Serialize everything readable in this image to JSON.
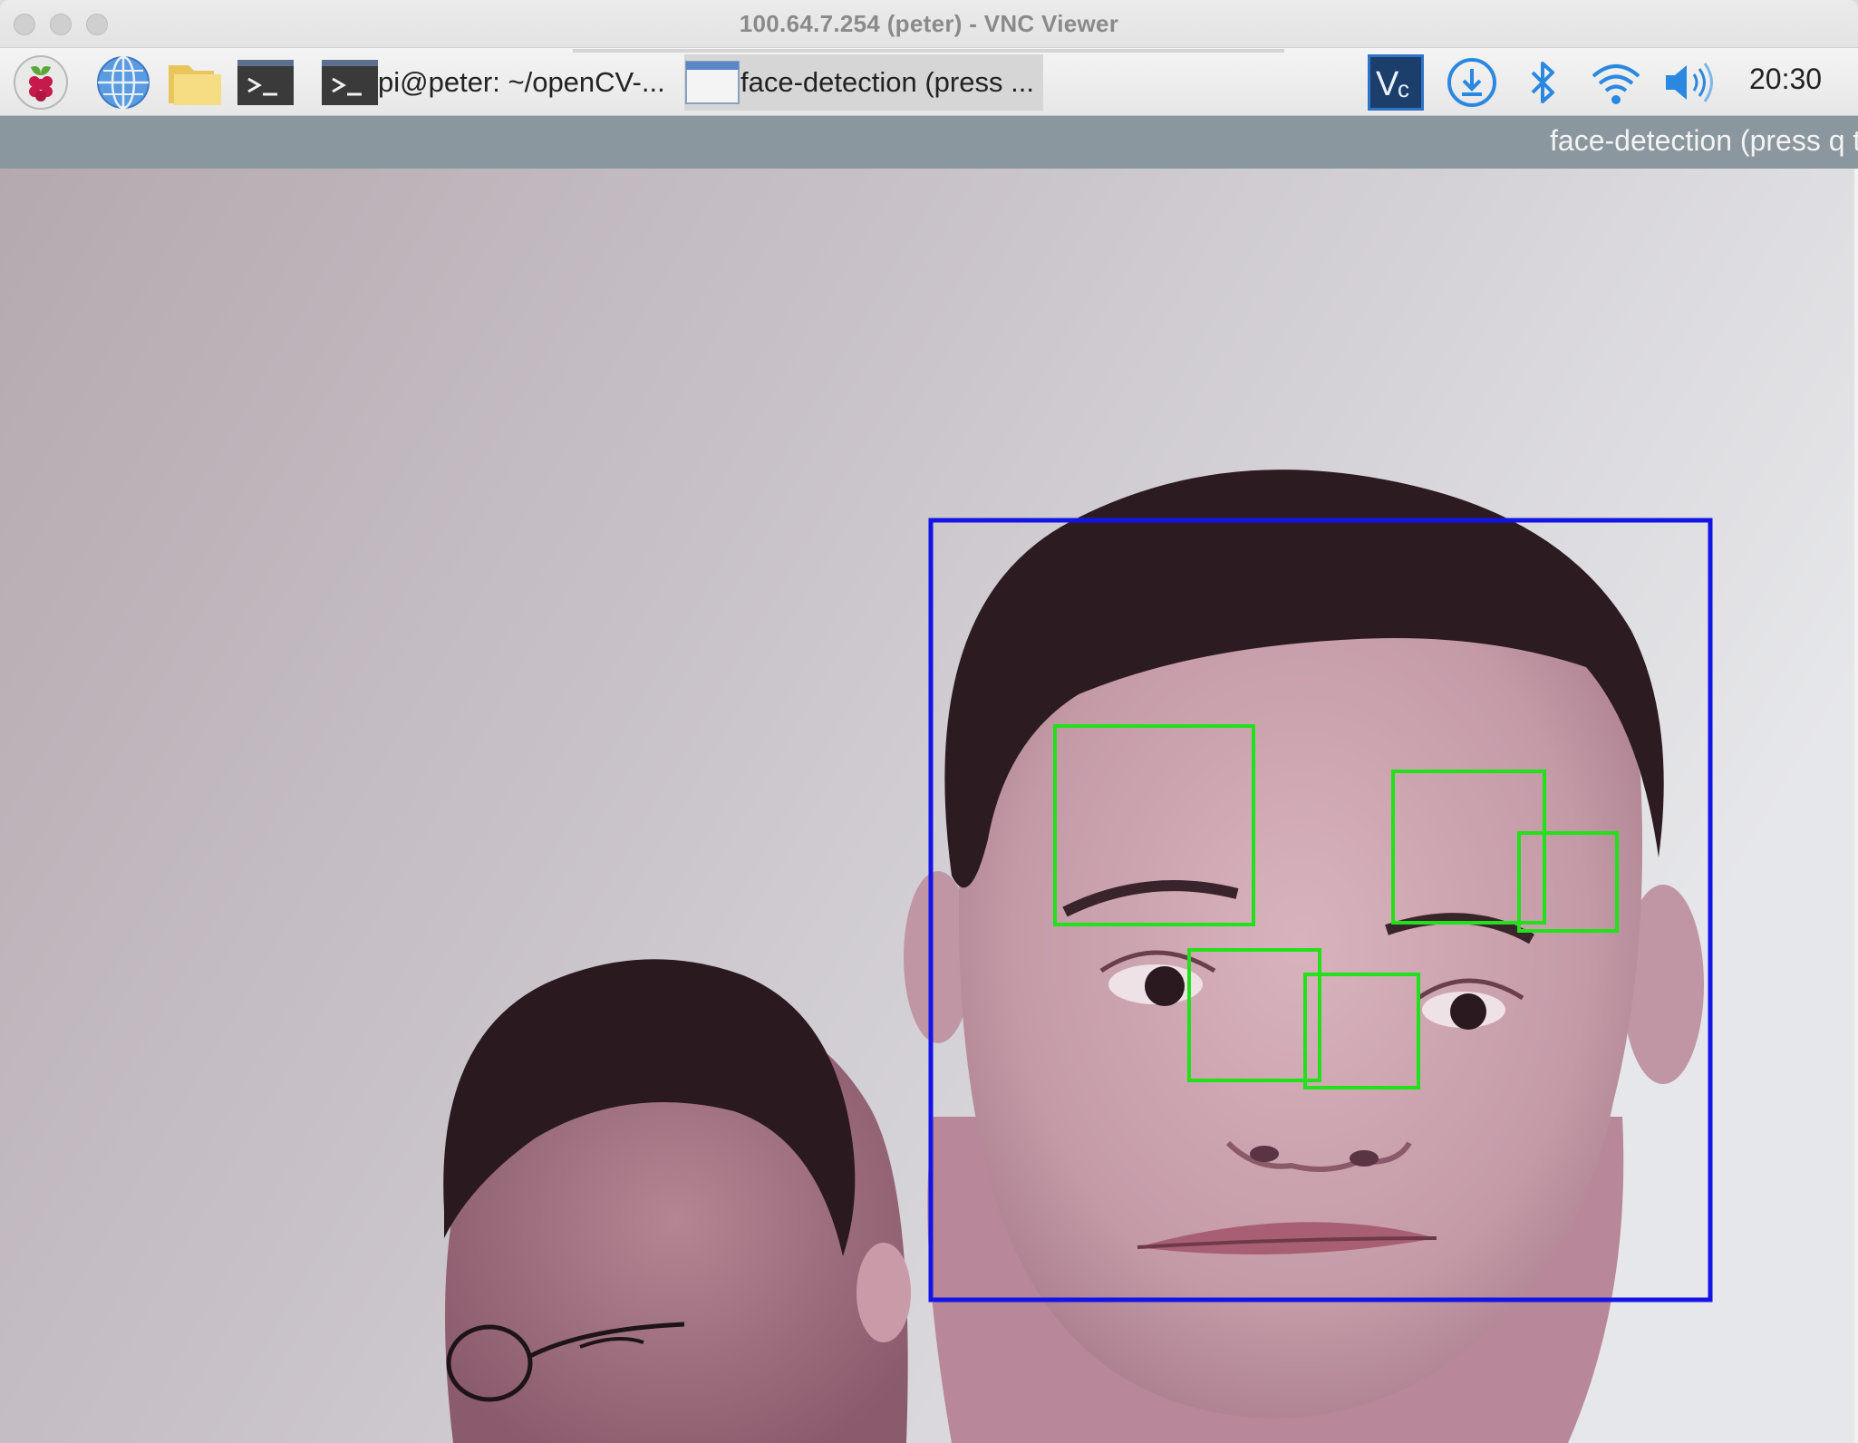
{
  "window": {
    "title": "100.64.7.254 (peter) - VNC Viewer"
  },
  "taskbar": {
    "launchers": [
      {
        "icon": "raspberry-menu-icon"
      },
      {
        "icon": "web-browser-globe-icon"
      },
      {
        "icon": "file-manager-folder-icon"
      },
      {
        "icon": "terminal-icon"
      }
    ],
    "tasks": [
      {
        "icon": "terminal-icon",
        "label": "pi@peter: ~/openCV-...",
        "active": false
      },
      {
        "icon": "window-icon",
        "label": "face-detection (press ...",
        "active": true
      }
    ],
    "tray": [
      {
        "icon": "vnc-server-icon"
      },
      {
        "icon": "download-updates-icon"
      },
      {
        "icon": "bluetooth-icon"
      },
      {
        "icon": "wifi-icon"
      },
      {
        "icon": "volume-icon"
      }
    ],
    "clock": "20:30"
  },
  "opencv_window": {
    "title": "face-detection (press q to quit)",
    "detections": {
      "face_box_color": "#1414e6",
      "feature_box_color": "#22e01a",
      "face_count": 1,
      "feature_count": 5
    }
  }
}
